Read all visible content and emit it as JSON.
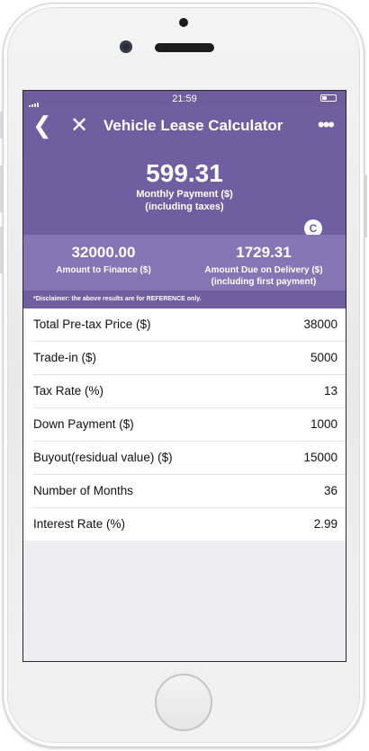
{
  "status_bar": {
    "time": "21:59"
  },
  "nav": {
    "title": "Vehicle Lease Calculator"
  },
  "result": {
    "monthly_payment": "599.31",
    "monthly_payment_label": "Monthly Payment ($)",
    "monthly_payment_sublabel": "(including taxes)"
  },
  "summary": {
    "finance_value": "32000.00",
    "finance_label": "Amount to Finance ($)",
    "delivery_value": "1729.31",
    "delivery_label": "Amount Due on Delivery ($)",
    "delivery_sublabel": "(including first payment)"
  },
  "disclaimer": "*Disclaimer: the above results are for REFERENCE only.",
  "inputs": [
    {
      "label": "Total Pre-tax Price ($)",
      "value": "38000"
    },
    {
      "label": "Trade-in ($)",
      "value": "5000"
    },
    {
      "label": "Tax Rate (%)",
      "value": "13"
    },
    {
      "label": "Down Payment ($)",
      "value": "1000"
    },
    {
      "label": "Buyout(residual value) ($)",
      "value": "15000"
    },
    {
      "label": "Number of Months",
      "value": "36"
    },
    {
      "label": "Interest Rate (%)",
      "value": "2.99"
    }
  ],
  "colors": {
    "header": "#6f5fa0",
    "summary": "#8575b4",
    "background": "#eeeef1"
  },
  "icons": {
    "back": "chevron-left-icon",
    "close": "close-icon",
    "more": "more-dots-icon",
    "refresh": "refresh-icon"
  }
}
